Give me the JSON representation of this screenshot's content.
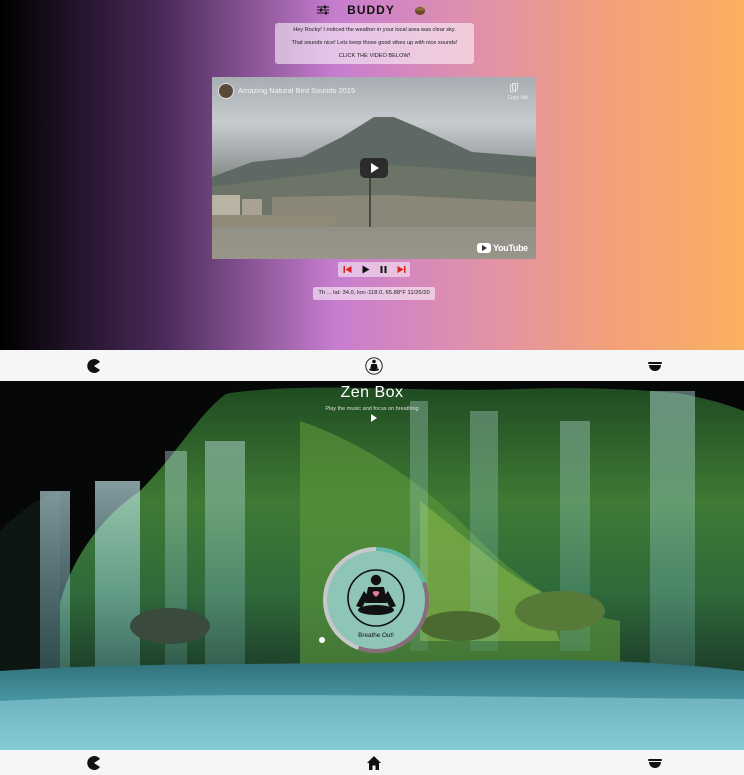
{
  "header": {
    "title": "BUDDY",
    "left_icon": "sliders-icon",
    "right_icon": "singing-bowl-icon"
  },
  "message": {
    "line1": "Hey Rocky! I noticed the weather in your local area was clear sky.",
    "line2": "That sounds nice! Lets keep those good vibes up with nice sounds!",
    "line3": "CLICK THE VIDEO BELOW!"
  },
  "video": {
    "title": "Amazing Natural Bird Sounds 2015",
    "copy_label": "Copy link",
    "brand": "YouTube"
  },
  "player_controls": {
    "buttons": [
      "skip-back-icon",
      "play-icon",
      "pause-icon",
      "skip-forward-icon"
    ],
    "accent_color": "#e0201c"
  },
  "status": {
    "text": "Th ... lat: 34.0, lon:-118.0, 65.88°F 11/26/20"
  },
  "nav": {
    "items": [
      "pacman-icon",
      "meditation-icon",
      "bowl-icon"
    ],
    "bottom_items": [
      "pacman-icon",
      "home-icon",
      "bowl-icon"
    ]
  },
  "zen": {
    "title": "Zen Box",
    "subtitle": "Play the music and focus on breathing",
    "breath_label": "Breathe Out!",
    "progress": 0.55,
    "ring_colors": [
      "#5fb7a7",
      "#8a6c7f",
      "#c9c7c9"
    ]
  },
  "colors": {
    "gradient": [
      "#000000",
      "#c77dcf",
      "#fbb060"
    ],
    "nav_background": "#f5f6f8"
  }
}
